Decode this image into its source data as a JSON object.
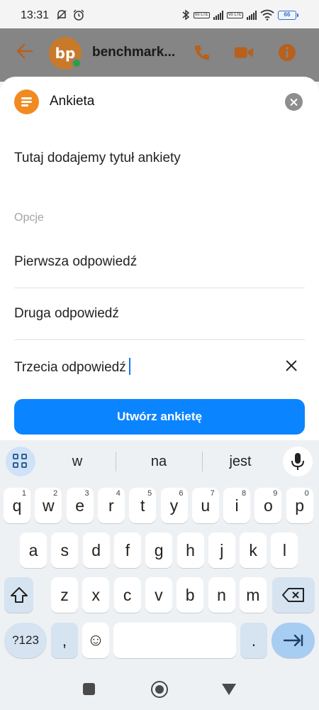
{
  "status_bar": {
    "time": "13:31",
    "battery": "66",
    "volte_label": "Vo LTE"
  },
  "chat_header": {
    "name": "benchmark...",
    "avatar_initials": "bp"
  },
  "poll_sheet": {
    "title": "Ankieta",
    "question": "Tutaj dodajemy tytuł ankiety",
    "options_label": "Opcje",
    "options": [
      {
        "text": "Pierwsza odpowiedź"
      },
      {
        "text": "Druga odpowiedź"
      },
      {
        "text": "Trzecia odpowiedź"
      }
    ],
    "create_button": "Utwórz ankietę"
  },
  "keyboard": {
    "suggestions": [
      "w",
      "na",
      "jest"
    ],
    "row1": [
      {
        "key": "q",
        "hint": "1"
      },
      {
        "key": "w",
        "hint": "2"
      },
      {
        "key": "e",
        "hint": "3"
      },
      {
        "key": "r",
        "hint": "4"
      },
      {
        "key": "t",
        "hint": "5"
      },
      {
        "key": "y",
        "hint": "6"
      },
      {
        "key": "u",
        "hint": "7"
      },
      {
        "key": "i",
        "hint": "8"
      },
      {
        "key": "o",
        "hint": "9"
      },
      {
        "key": "p",
        "hint": "0"
      }
    ],
    "row2": [
      "a",
      "s",
      "d",
      "f",
      "g",
      "h",
      "j",
      "k",
      "l"
    ],
    "row3": [
      "z",
      "x",
      "c",
      "v",
      "b",
      "n",
      "m"
    ],
    "symbols_key": "?123",
    "comma_key": ",",
    "period_key": ".",
    "emoji_key": "☺"
  },
  "colors": {
    "accent": "#0b84ff",
    "poll_badge": "#f28a22",
    "header_icons": "#c86a1e",
    "online": "#2f9e44"
  },
  "icons": {
    "back": "arrow-left-icon",
    "call": "phone-icon",
    "video": "video-camera-icon",
    "info": "info-icon",
    "poll": "poll-list-icon",
    "close": "close-circle-icon",
    "remove_option": "x-icon",
    "keyboard_menu": "grid-apps-icon",
    "mic": "microphone-icon",
    "shift": "shift-arrow-icon",
    "backspace": "backspace-icon",
    "enter": "enter-arrow-icon",
    "nav_recents": "square-icon",
    "nav_home": "circle-icon",
    "nav_back": "triangle-icon"
  }
}
